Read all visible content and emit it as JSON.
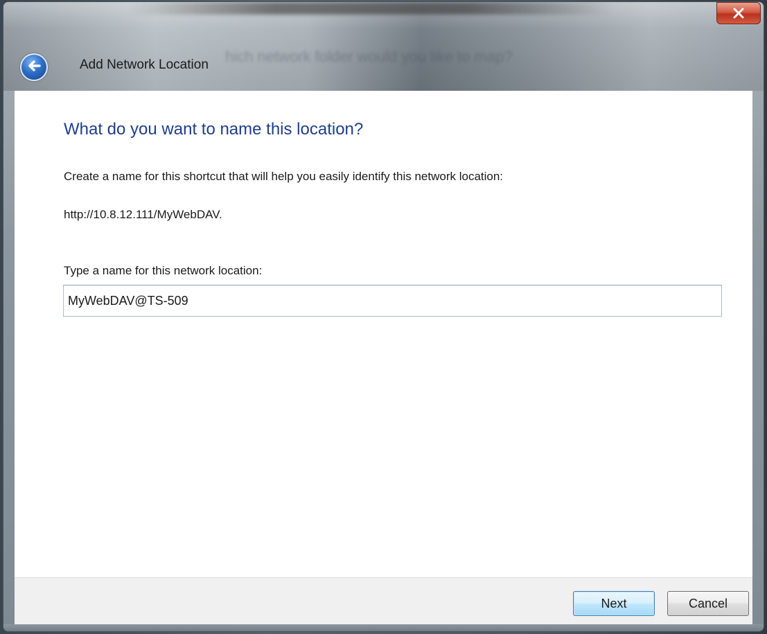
{
  "window": {
    "title": "Add Network Location",
    "background_ghost_text": "hich network folder would you like to map?"
  },
  "colors": {
    "heading": "#1e3e8c",
    "close_button": "#c9452d",
    "back_button": "#2f6fc8",
    "footer": "#f0f0f0"
  },
  "icons": {
    "back": "back-arrow-icon",
    "close": "close-x-icon"
  },
  "main": {
    "heading": "What do you want to name this location?",
    "description": "Create a name for this shortcut that will help you easily identify this network location:",
    "url": "http://10.8.12.111/MyWebDAV.",
    "field_label": "Type a name for this network location:",
    "name_value": "MyWebDAV@TS-509"
  },
  "footer": {
    "next_label": "Next",
    "cancel_label": "Cancel"
  }
}
